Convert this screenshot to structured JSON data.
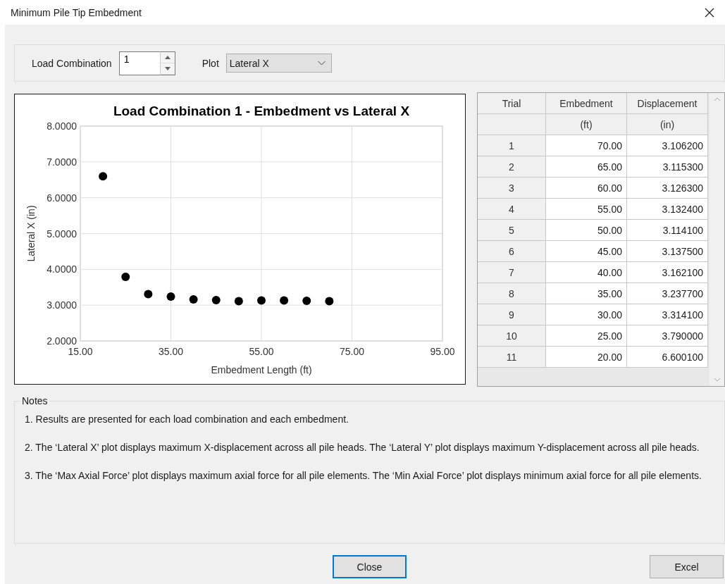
{
  "window": {
    "title": "Minimum Pile Tip Embedment"
  },
  "controls": {
    "load_combination_label": "Load Combination",
    "load_combination_value": "1",
    "plot_label": "Plot",
    "plot_value": "Lateral X"
  },
  "chart": {
    "chart_data": {
      "type": "scatter",
      "title": "Load Combination 1 - Embedment vs Lateral X",
      "xlabel": "Embedment Length (ft)",
      "ylabel": "Lateral X (in)",
      "x": [
        70,
        65,
        60,
        55,
        50,
        45,
        40,
        35,
        30,
        25,
        20
      ],
      "series": [
        {
          "color": "#000000",
          "values": [
            3.11,
            3.12,
            3.13,
            3.13,
            3.11,
            3.14,
            3.16,
            3.24,
            3.31,
            3.79,
            6.6
          ]
        }
      ],
      "grid": true,
      "xlim": [
        15,
        95
      ],
      "ylim": [
        2,
        8
      ],
      "xticks": [
        {
          "value": 15,
          "label": "15.00"
        },
        {
          "value": 35,
          "label": "35.00"
        },
        {
          "value": 55,
          "label": "55.00"
        },
        {
          "value": 75,
          "label": "75.00"
        },
        {
          "value": 95,
          "label": "95.00"
        }
      ],
      "yticks": [
        {
          "value": 2,
          "label": "2.0000"
        },
        {
          "value": 3,
          "label": "3.0000"
        },
        {
          "value": 4,
          "label": "4.0000"
        },
        {
          "value": 5,
          "label": "5.0000"
        },
        {
          "value": 6,
          "label": "6.0000"
        },
        {
          "value": 7,
          "label": "7.0000"
        },
        {
          "value": 8,
          "label": "8.0000"
        }
      ]
    }
  },
  "table": {
    "columns": [
      {
        "label": "Trial"
      },
      {
        "label": "Embedment",
        "unit": "(ft)"
      },
      {
        "label": "Displacement",
        "unit": "(in)"
      }
    ],
    "rows": [
      {
        "trial": "1",
        "embedment": "70.00",
        "displacement": "3.106200"
      },
      {
        "trial": "2",
        "embedment": "65.00",
        "displacement": "3.115300"
      },
      {
        "trial": "3",
        "embedment": "60.00",
        "displacement": "3.126300"
      },
      {
        "trial": "4",
        "embedment": "55.00",
        "displacement": "3.132400"
      },
      {
        "trial": "5",
        "embedment": "50.00",
        "displacement": "3.114100"
      },
      {
        "trial": "6",
        "embedment": "45.00",
        "displacement": "3.137500"
      },
      {
        "trial": "7",
        "embedment": "40.00",
        "displacement": "3.162100"
      },
      {
        "trial": "8",
        "embedment": "35.00",
        "displacement": "3.237700"
      },
      {
        "trial": "9",
        "embedment": "30.00",
        "displacement": "3.314100"
      },
      {
        "trial": "10",
        "embedment": "25.00",
        "displacement": "3.790000"
      },
      {
        "trial": "11",
        "embedment": "20.00",
        "displacement": "6.600100"
      }
    ]
  },
  "notes": {
    "title": "Notes",
    "paragraphs": [
      "1. Results are presented for each load combination and each embedment.",
      "2. The ‘Lateral X’ plot displays maximum X-displacement across all pile heads. The ‘Lateral Y’ plot displays maximum Y-displacement across all pile heads.",
      "3. The ‘Max Axial Force’ plot displays maximum axial force for all pile elements. The ‘Min Axial Force’ plot displays minimum axial force for all pile elements."
    ]
  },
  "buttons": [
    {
      "label": "Close",
      "focused": true
    },
    {
      "label": "Excel",
      "focused": false
    }
  ]
}
